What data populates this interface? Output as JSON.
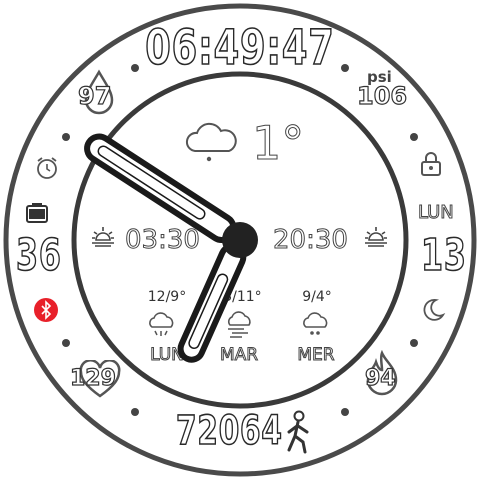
{
  "time_top": "06:49:47",
  "weather": {
    "temperature": "1°",
    "icon": "partly-cloudy-night-icon"
  },
  "sunrise": {
    "time": "03:30",
    "icon": "sunrise-icon"
  },
  "sunset": {
    "time": "20:30",
    "icon": "sunset-icon"
  },
  "complications": {
    "humidity": "97",
    "pressure_label": "psi",
    "pressure": "106",
    "battery": "36",
    "day_name": "LUN",
    "day_number": "13",
    "heart_rate": "129",
    "calories": "94",
    "steps": "72064"
  },
  "forecast": [
    {
      "temps": "12/9°",
      "day": "LUN",
      "icon": "snow-cloud-icon"
    },
    {
      "temps": "13/11°",
      "day": "MAR",
      "icon": "windy-snow-icon"
    },
    {
      "temps": "9/4°",
      "day": "MER",
      "icon": "cloud-snow-icon"
    }
  ],
  "status_icons": [
    "alarm-icon",
    "lock-icon",
    "battery-icon",
    "bluetooth-icon",
    "moon-icon"
  ],
  "colors": {
    "bluetooth": "#e8202a",
    "hand_fill": "#ffffff",
    "hand_stroke": "#1a1a1a",
    "hub": "#222222"
  }
}
